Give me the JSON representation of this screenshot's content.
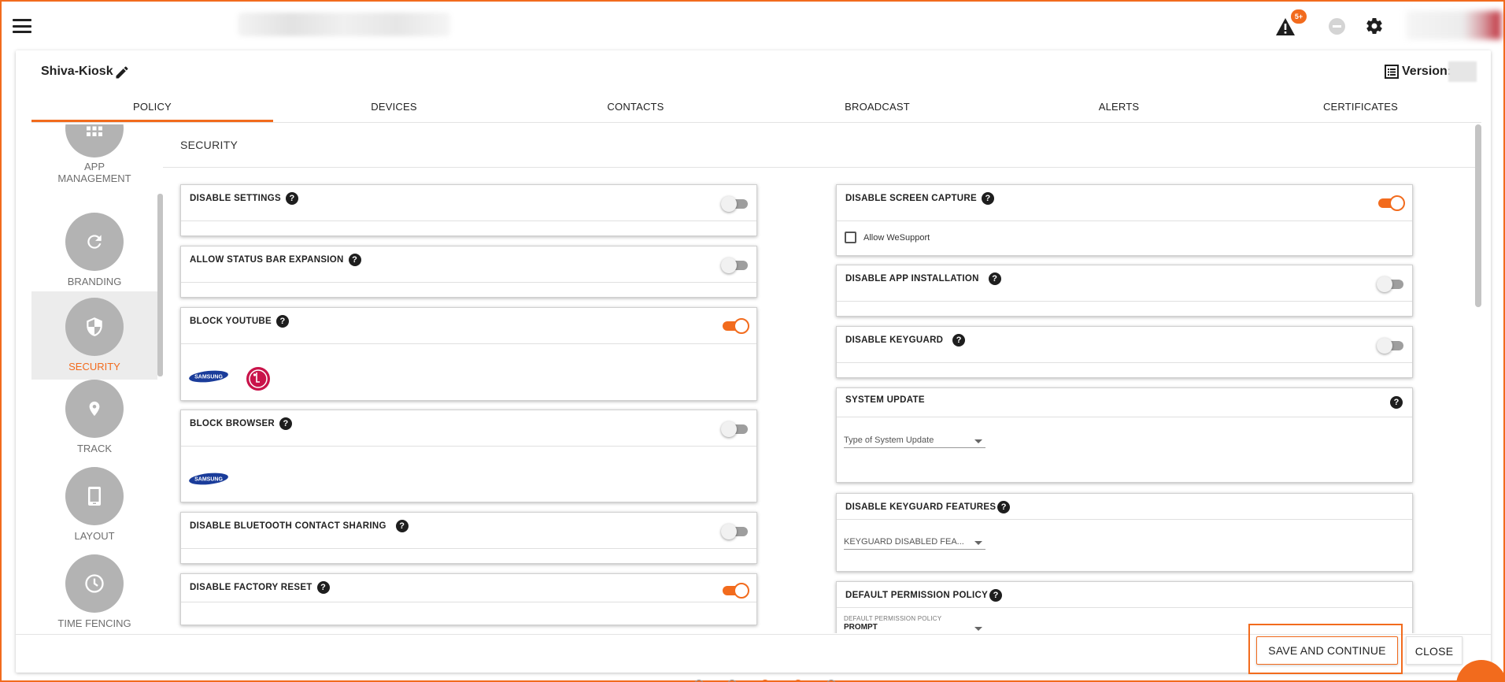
{
  "header": {
    "menu_icon": "hamburger-icon",
    "alert_badge": "5+",
    "icons": [
      "alert-triangle-icon",
      "minus-circle-icon",
      "gear-icon"
    ]
  },
  "policy": {
    "name": "Shiva-Kiosk",
    "version_label": "Version:"
  },
  "tabs": [
    {
      "label": "POLICY",
      "active": true
    },
    {
      "label": "DEVICES",
      "active": false
    },
    {
      "label": "CONTACTS",
      "active": false
    },
    {
      "label": "BROADCAST",
      "active": false
    },
    {
      "label": "ALERTS",
      "active": false
    },
    {
      "label": "CERTIFICATES",
      "active": false
    }
  ],
  "sidenav": {
    "items": [
      {
        "label_line1": "APP",
        "label_line2": "MANAGEMENT",
        "icon": "grid-icon"
      },
      {
        "label": "BRANDING",
        "icon": "refresh-icon"
      },
      {
        "label": "SECURITY",
        "icon": "shield-icon",
        "active": true
      },
      {
        "label": "TRACK",
        "icon": "location-pin-icon"
      },
      {
        "label": "LAYOUT",
        "icon": "phone-icon"
      },
      {
        "label": "TIME FENCING",
        "icon": "clock-icon"
      }
    ]
  },
  "section": {
    "title": "SECURITY"
  },
  "left_settings": {
    "disable_settings": {
      "title": "DISABLE SETTINGS",
      "enabled": false
    },
    "allow_status_bar": {
      "title": "ALLOW STATUS BAR EXPANSION",
      "enabled": false
    },
    "block_youtube": {
      "title": "BLOCK YOUTUBE",
      "enabled": true,
      "brands": [
        "samsung-logo",
        "lg-logo"
      ]
    },
    "block_browser": {
      "title": "BLOCK BROWSER",
      "enabled": false,
      "brands": [
        "samsung-logo"
      ]
    },
    "disable_bt_contact": {
      "title": "DISABLE BLUETOOTH CONTACT SHARING",
      "enabled": false
    },
    "disable_factory_reset": {
      "title": "DISABLE FACTORY RESET",
      "enabled": true
    }
  },
  "right_settings": {
    "disable_screen_capture": {
      "title": "DISABLE SCREEN CAPTURE",
      "enabled": true,
      "checkbox_label": "Allow WeSupport",
      "checked": false
    },
    "disable_app_installation": {
      "title": "DISABLE APP INSTALLATION",
      "enabled": false
    },
    "disable_keyguard": {
      "title": "DISABLE KEYGUARD",
      "enabled": false
    },
    "system_update": {
      "title": "SYSTEM UPDATE",
      "select_placeholder": "Type of System Update"
    },
    "keyguard_features": {
      "title": "DISABLE KEYGUARD FEATURES",
      "select_placeholder": "KEYGUARD DISABLED FEA..."
    },
    "default_permission": {
      "title": "DEFAULT PERMISSION POLICY",
      "field_label": "DEFAULT PERMISSION POLICY",
      "field_value": "PROMPT"
    }
  },
  "footer": {
    "save_label": "SAVE AND CONTINUE",
    "close_label": "CLOSE"
  },
  "colors": {
    "accent": "#f26b1d",
    "nav_circle": "#b3b3b3",
    "toggle_off": "#9e9e9e"
  }
}
